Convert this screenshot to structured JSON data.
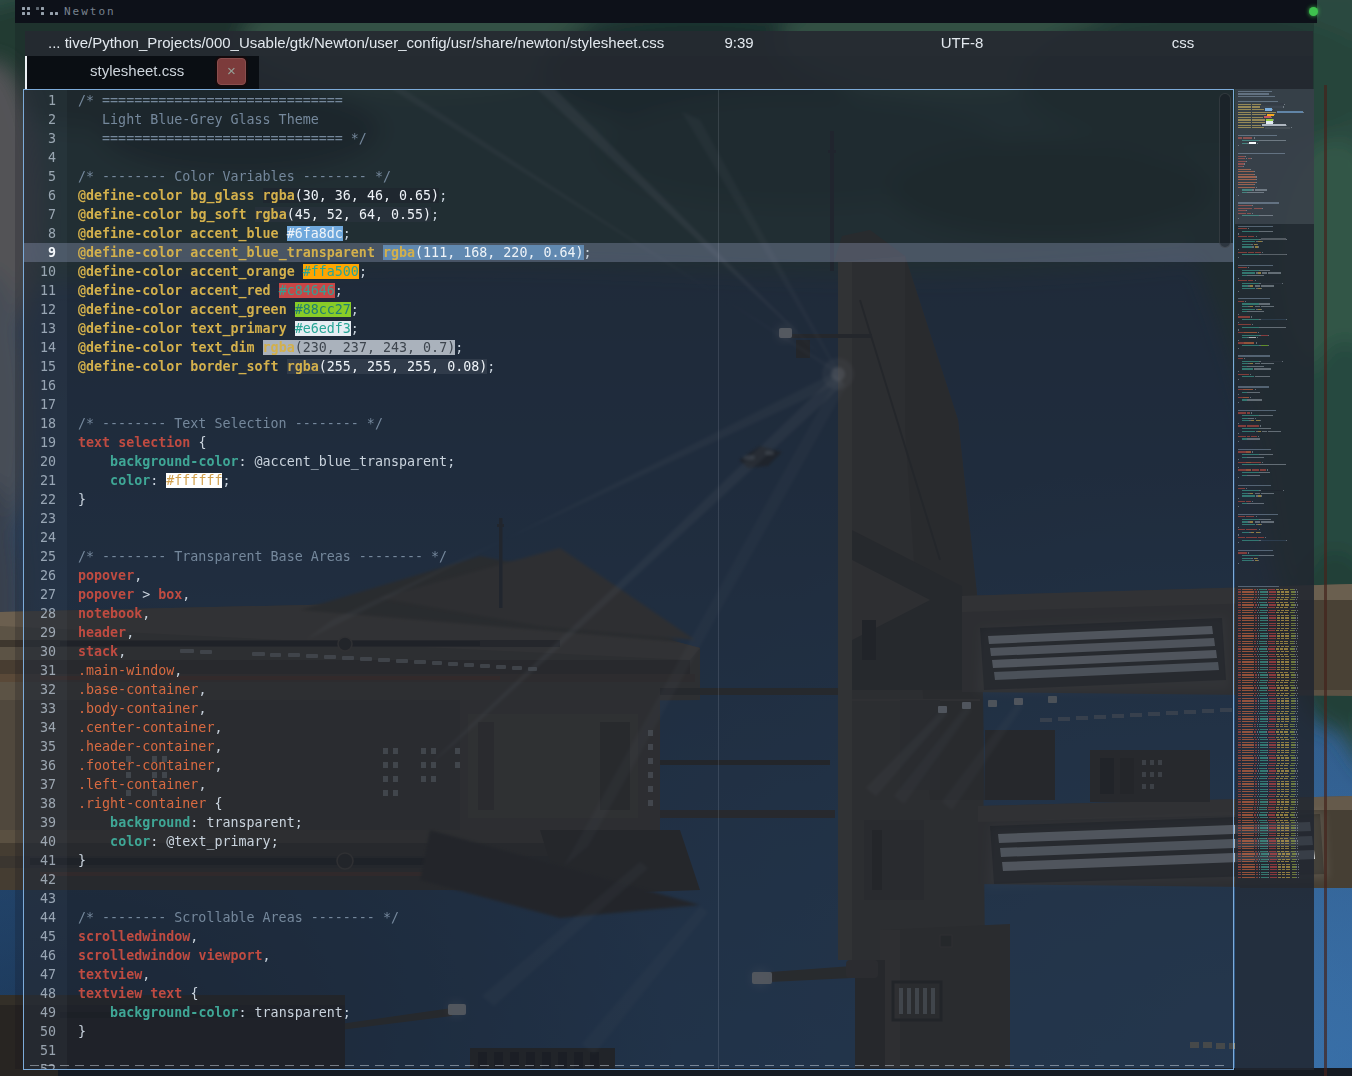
{
  "window": {
    "title": "Newton",
    "workspace_indicators": [
      {
        "name": "workspace-dots-1",
        "pattern": [
          1,
          1,
          1,
          1
        ]
      },
      {
        "name": "workspace-dots-2",
        "pattern": [
          1,
          1,
          0,
          1
        ]
      },
      {
        "name": "workspace-dots-3",
        "pattern": [
          0,
          0,
          1,
          1
        ]
      }
    ],
    "status_dot_color": "#3ec14e"
  },
  "pathbar": {
    "path": "... tive/Python_Projects/000_Usable/gtk/Newton/user_config/usr/share/newton/stylesheet.css",
    "cursor_position": "9:39",
    "encoding": "UTF-8",
    "language": "css"
  },
  "tabbar": {
    "tabs": [
      {
        "label": "stylesheet.css",
        "active": true,
        "close_label": "×"
      }
    ]
  },
  "editor": {
    "current_line": 9,
    "total_visible_lines": 52,
    "syntax_colors": {
      "comment": "#75889c",
      "keyword": "#d3b04c",
      "selector_element": "#bf4b41",
      "selector_class": "#d96a41",
      "property": "#3fa796",
      "foreground": "#c9d3dd",
      "number": "#d3b04c",
      "swatch_text_light": "#eef3f8",
      "swatch_text_dark": "#3e454e"
    },
    "hex_swatch_text": {
      "#6fa8dc": "#eef3f8",
      "#ffa500": "#27a596",
      "#c84646": "#35a093",
      "#88cc27": "#227f72",
      "#e6edf3": "#27a596",
      "#ffffff": "#d2a14e",
      "#9a4": "#99aa44"
    },
    "lines": [
      "/* ==============================",
      "   Light Blue-Grey Glass Theme",
      "   ============================== */",
      "",
      "/* -------- Color Variables -------- */",
      "@define-color bg_glass rgba(30, 36, 46, 0.65);",
      "@define-color bg_soft rgba(45, 52, 64, 0.55);",
      "@define-color accent_blue #6fa8dc;",
      "@define-color accent_blue_transparent rgba(111, 168, 220, 0.64);",
      "@define-color accent_orange #ffa500;",
      "@define-color accent_red #c84646;",
      "@define-color accent_green #88cc27;",
      "@define-color text_primary #e6edf3;",
      "@define-color text_dim rgba(230, 237, 243, 0.7);",
      "@define-color border_soft rgba(255, 255, 255, 0.08);",
      "",
      "",
      "/* -------- Text Selection -------- */",
      "text selection {",
      "    background-color: @accent_blue_transparent;",
      "    color: #ffffff;",
      "}",
      "",
      "",
      "/* -------- Transparent Base Areas -------- */",
      "popover,",
      "popover > box,",
      "notebook,",
      "header,",
      "stack,",
      ".main-window,",
      ".base-container,",
      ".body-container,",
      ".center-container,",
      ".header-container,",
      ".footer-container,",
      ".left-container,",
      ".right-container {",
      "    background: transparent;",
      "    color: @text_primary;",
      "}",
      "",
      "",
      "/* -------- Scrollable Areas -------- */",
      "scrolledwindow,",
      "scrolledwindow viewport,",
      "textview,",
      "textview text {",
      "    background-color: transparent;",
      "}",
      "",
      ""
    ],
    "file_continuation": [
      "/* -------- Scrollbars -------- */",
      "scrollbar {",
      "    background-color: transparent;",
      "}",
      "scrollbar slider {",
      "    background-color: rgba(230, 237, 243, 0.25);",
      "    border-radius: 10px;",
      "    min-width: 8px;",
      "    min-height: 8px;",
      "}",
      "scrollbar slider:hover {",
      "    background-color: rgba(230, 237, 243, 0.45);",
      "}",
      "",
      "",
      "/* -------- Header Bar -------- */",
      "headerbar {",
      "    background-color: @bg_soft;",
      "    border-bottom: 1px solid @border_soft;",
      "    color: @text_primary;",
      "}",
      "headerbar entry {",
      "    background-color: rgba(45, 52, 64, 0.8);",
      "    border: 1px solid @border_soft;",
      "    border-radius: 4px;",
      "}",
      "",
      "",
      "/* -------- Buttons -------- */",
      "button {",
      "    background-color: @bg_soft;",
      "    border: 1px solid @border_soft;",
      "    border-radius: 4px;",
      "    color: @text_primary;",
      "}",
      "button:hover {",
      "    background-color: rgba(111, 168, 220, 0.25);",
      "}",
      "button:active {",
      "    background-color: @accent_blue_transparent;",
      "}",
      "button.destructive {",
      "    background-color: #c84646;",
      "    color: #ffffff;",
      "}",
      "button.suggested {",
      "    background-color: #88cc27;",
      "}",
      "",
      "",
      "/* -------- Entries -------- */",
      "entry {",
      "    background-color: rgba(45, 52, 64, 0.8);",
      "    border: 1px solid @border_soft;",
      "    color: @text_primary;",
      "    caret-color: @accent_orange;",
      "}",
      "entry:focus {",
      "    border-color: @accent_blue;",
      "}",
      "",
      "",
      "/* -------- Labels -------- */",
      "label.dim-label {",
      "    color: @text_dim;",
      "}",
      "label.error {",
      "    color: @accent_red;",
      "}",
      "",
      "",
      "/* -------- Notebook Tabs -------- */",
      "notebook tab {",
      "    background-color: transparent;",
      "    border: none;",
      "    padding: 6px 12px;",
      "}",
      "notebook tab:checked {",
      "    background-color: @bg_glass;",
      "    border-bottom: 2px solid @accent_blue;",
      "}",
      "notebook tab label {",
      "    color: @text_dim;",
      "}",
      "",
      "",
      "/* -------- Treeview -------- */",
      "treeview.view {",
      "    background-color: transparent;",
      "    color: @text_primary;",
      "}",
      "treeview.view:selected {",
      "    background-color: @accent_blue_transparent;",
      "}",
      "treeview.view header button {",
      "    background-color: @bg_soft;",
      "    color: @text_dim;",
      "}",
      "",
      "",
      "/* -------- Tooltips -------- */",
      "tooltip {",
      "    background-color: rgba(30, 36, 46, 0.95);",
      "    border: 1px solid @border_soft;",
      "    border-radius: 4px;",
      "}",
      "tooltip label {",
      "    color: @text_primary;",
      "}",
      "",
      "",
      "/* -------- Popover Content -------- */",
      "popover contents {",
      "    background-color: @bg_glass;",
      "    border: 1px solid @border_soft;",
      "    border-radius: 6px;",
      "}",
      "popover modelbutton {",
      "    padding: 4px 10px;",
      "}",
      "popover modelbutton:hover {",
      "    background-color: rgba(111, 168, 220, 0.25);",
      "}",
      "",
      "",
      "/* -------- Separators -------- */",
      "separator {",
      "    background-color: @border_soft;",
      "    min-width: 1px;",
      "    min-height: 1px;",
      "}",
      "",
      "",
      "",
      "",
      "",
      "",
      "",
      "",
      "/* -------- Syntax Mark Rows -------- */",
      "row .mark-kw-00:i { outline: #c84646 1px 2px 0.10 #9a4; }",
      "row .mark-str-01:i { outline: #c84646 2px 3px 0.17 #9a4; }",
      "row .mark-cmt-02:i { outline: #c84646 3px 4px 0.24 #9a4; }",
      "row .mark-num-03:i { outline: #c84646 1px 5px 0.31 #9a4; }",
      "row .mark-fn-04:i { outline: #c84646 2px 2px 0.38 #9a4; }",
      "row .mark-op-05:i { outline: #c84646 3px 3px 0.45 #9a4; }",
      "row .mark-lit-06:i { outline: #c84646 1px 4px 0.52 #9a4; }",
      "row .mark-hd-07:i { outline: #c84646 2px 5px 0.59 #9a4; }",
      "row .mark-pre-08:i { outline: #c84646 3px 2px 0.66 #9a4; }",
      "row .mark-sp-09:i { outline: #c84646 1px 3px 0.73 #9a4; }",
      "row .mark-var-10:i { outline: #c84646 2px 4px 0.80 #9a4; }",
      "row .mark-cls-11:i { outline: #c84646 3px 5px 0.87 #9a4; }",
      "row .mark-tag-12:i { outline: #c84646 1px 2px 0.94 #9a4; }",
      "row .mark-att-13:i { outline: #c84646 2px 3px 0.16 #9a4; }",
      "row .mark-sel-14:i { outline: #c84646 3px 4px 0.23 #9a4; }",
      "row .mark-tok-15:i { outline: #c84646 1px 5px 0.30 #9a4; }",
      "row .mark-kw-16:i { outline: #c84646 2px 2px 0.37 #9a4; }",
      "row .mark-str-17:i { outline: #c84646 3px 3px 0.44 #9a4; }",
      "row .mark-cmt-18:i { outline: #c84646 1px 4px 0.51 #9a4; }",
      "row .mark-num-19:i { outline: #c84646 2px 5px 0.58 #9a4; }",
      "row .mark-fn-20:i { outline: #c84646 3px 2px 0.65 #9a4; }",
      "row .mark-op-21:i { outline: #c84646 1px 3px 0.72 #9a4; }",
      "row .mark-lit-22:i { outline: #c84646 2px 4px 0.79 #9a4; }",
      "row .mark-hd-23:i { outline: #c84646 3px 5px 0.86 #9a4; }",
      "row .mark-pre-24:i { outline: #c84646 1px 2px 0.93 #9a4; }",
      "row .mark-sp-25:i { outline: #c84646 2px 3px 0.15 #9a4; }",
      "row .mark-var-26:i { outline: #c84646 3px 4px 0.22 #9a4; }",
      "row .mark-cls-27:i { outline: #c84646 1px 5px 0.29 #9a4; }",
      "row .mark-tag-28:i { outline: #c84646 2px 2px 0.36 #9a4; }",
      "row .mark-att-29:i { outline: #c84646 3px 3px 0.43 #9a4; }",
      "row .mark-sel-30:i { outline: #c84646 1px 4px 0.50 #9a4; }",
      "row .mark-tok-31:i { outline: #c84646 2px 5px 0.57 #9a4; }",
      "row .mark-kw-32:i { outline: #c84646 3px 2px 0.64 #9a4; }",
      "row .mark-str-33:i { outline: #c84646 1px 3px 0.71 #9a4; }",
      "row .mark-cmt-34:i { outline: #c84646 2px 4px 0.78 #9a4; }",
      "row .mark-num-35:i { outline: #c84646 3px 5px 0.85 #9a4; }",
      "row .mark-fn-36:i { outline: #c84646 1px 2px 0.92 #9a4; }",
      "row .mark-op-37:i { outline: #c84646 2px 3px 0.14 #9a4; }",
      "row .mark-lit-38:i { outline: #c84646 3px 4px 0.21 #9a4; }",
      "row .mark-hd-39:i { outline: #c84646 1px 5px 0.28 #9a4; }",
      "row .mark-pre-40:i { outline: #c84646 2px 2px 0.35 #9a4; }",
      "row .mark-sp-41:i { outline: #c84646 3px 3px 0.42 #9a4; }",
      "row .mark-var-42:i { outline: #c84646 1px 4px 0.49 #9a4; }",
      "row .mark-cls-43:i { outline: #c84646 2px 5px 0.56 #9a4; }",
      "row .mark-tag-44:i { outline: #c84646 3px 2px 0.63 #9a4; }",
      "row .mark-att-45:i { outline: #c84646 1px 3px 0.70 #9a4; }",
      "row .mark-sel-46:i { outline: #c84646 2px 4px 0.77 #9a4; }",
      "row .mark-tok-47:i { outline: #c84646 3px 5px 0.84 #9a4; }",
      "row .mark-kw-48:i { outline: #c84646 1px 2px 0.91 #9a4; }",
      "row .mark-str-49:i { outline: #c84646 2px 3px 0.13 #9a4; }",
      "row .mark-cmt-50:i { outline: #c84646 3px 4px 0.20 #9a4; }",
      "row .mark-num-51:i { outline: #c84646 1px 5px 0.27 #9a4; }",
      "row .mark-fn-52:i { outline: #c84646 2px 2px 0.34 #9a4; }",
      "row .mark-op-53:i { outline: #c84646 3px 3px 0.41 #9a4; }",
      "row .mark-lit-54:i { outline: #c84646 1px 4px 0.48 #9a4; }",
      "row .mark-hd-55:i { outline: #c84646 2px 5px 0.55 #9a4; }",
      "row .mark-pre-56:i { outline: #c84646 3px 2px 0.62 #9a4; }",
      "row .mark-sp-57:i { outline: #c84646 1px 3px 0.69 #9a4; }",
      "row .mark-var-58:i { outline: #c84646 2px 4px 0.76 #9a4; }",
      "row .mark-cls-59:i { outline: #c84646 3px 5px 0.83 #9a4; }",
      "row .mark-tag-60:i { outline: #c84646 1px 2px 0.90 #9a4; }",
      "row .mark-att-61:i { outline: #c84646 2px 3px 0.12 #9a4; }",
      "row .mark-sel-62:i { outline: #c84646 3px 4px 0.19 #9a4; }",
      "row .mark-tok-63:i { outline: #c84646 1px 5px 0.26 #9a4; }",
      "row .mark-kw-64:i { outline: #c84646 2px 2px 0.33 #9a4; }",
      "row .mark-str-65:i { outline: #c84646 3px 3px 0.40 #9a4; }",
      "row .mark-cmt-66:i { outline: #c84646 1px 4px 0.47 #9a4; }",
      "row .mark-num-67:i { outline: #c84646 2px 5px 0.54 #9a4; }",
      "row .mark-fn-68:i { outline: #c84646 3px 2px 0.61 #9a4; }",
      "row .mark-op-69:i { outline: #c84646 1px 3px 0.68 #9a4; }",
      "row .mark-lit-70:i { outline: #c84646 2px 4px 0.75 #9a4; }",
      "row .mark-hd-71:i { outline: #c84646 3px 5px 0.82 #9a4; }",
      "row .mark-pre-72:i { outline: #c84646 1px 2px 0.89 #9a4; }",
      "row .mark-sp-73:i { outline: #c84646 2px 3px 0.11 #9a4; }",
      "row .mark-var-74:i { outline: #c84646 3px 4px 0.18 #9a4; }",
      "row .mark-cls-75:i { outline: #c84646 1px 5px 0.25 #9a4; }",
      "row .mark-tag-76:i { outline: #c84646 2px 2px 0.32 #9a4; }",
      "row .mark-att-77:i { outline: #c84646 3px 3px 0.39 #9a4; }",
      "row .mark-sel-78:i { outline: #c84646 1px 4px 0.46 #9a4; }",
      "row .mark-tok-79:i { outline: #c84646 2px 5px 0.53 #9a4; }",
      "row .mark-kw-80:i { outline: #c84646 3px 2px 0.60 #9a4; }",
      "row .mark-str-81:i { outline: #c84646 1px 3px 0.67 #9a4; }",
      "row .mark-cmt-82:i { outline: #c84646 2px 4px 0.74 #9a4; }",
      "row .mark-num-83:i { outline: #c84646 3px 5px 0.81 #9a4; }",
      "row .mark-fn-84:i { outline: #c84646 1px 2px 0.88 #9a4; }",
      "row .mark-op-85:i { outline: #c84646 2px 3px 0.10 #9a4; }",
      "row .mark-lit-86:i { outline: #c84646 3px 4px 0.17 #9a4; }",
      "row .mark-hd-87:i { outline: #c84646 1px 5px 0.24 #9a4; }",
      "row .mark-pre-88:i { outline: #c84646 2px 2px 0.31 #9a4; }",
      "row .mark-sp-89:i { outline: #c84646 3px 3px 0.38 #9a4; }",
      "row .mark-var-90:i { outline: #c84646 1px 4px 0.45 #9a4; }",
      "row .mark-cls-91:i { outline: #c84646 2px 5px 0.52 #9a4; }",
      "row .mark-tag-92:i { outline: #c84646 3px 2px 0.59 #9a4; }",
      "row .mark-att-93:i { outline: #c84646 1px 3px 0.66 #9a4; }",
      "row .mark-sel-94:i { outline: #c84646 2px 4px 0.73 #9a4; }",
      "row .mark-tok-95:i { outline: #c84646 3px 5px 0.80 #9a4; }",
      "row .mark-kw-96:i { outline: #c84646 1px 2px 0.87 #9a4; }",
      "row .mark-str-97:i { outline: #c84646 2px 3px 0.94 #9a4; }",
      "row .mark-cmt-98:i { outline: #c84646 3px 4px 0.16 #9a4; }",
      "row .mark-num-99:i { outline: #c84646 1px 5px 0.23 #9a4; }",
      "row .mark-fn-100:i { outline: #c84646 2px 2px 0.30 #9a4; }",
      "row .mark-op-101:i { outline: #c84646 3px 3px 0.37 #9a4; }",
      "row .mark-lit-102:i { outline: #c84646 1px 4px 0.44 #9a4; }",
      "row .mark-hd-103:i { outline: #c84646 2px 5px 0.51 #9a4; }",
      "row .mark-pre-104:i { outline: #c84646 3px 2px 0.58 #9a4; }",
      "row .mark-sp-105:i { outline: #c84646 1px 3px 0.65 #9a4; }",
      "row .mark-var-106:i { outline: #c84646 2px 4px 0.72 #9a4; }",
      "row .mark-cls-107:i { outline: #c84646 3px 5px 0.79 #9a4; }",
      "row .mark-tag-108:i { outline: #c84646 1px 2px 0.86 #9a4; }",
      "row .mark-att-109:i { outline: #c84646 2px 3px 0.93 #9a4; }",
      "row .mark-sel-110:i { outline: #c84646 3px 4px 0.15 #9a4; }",
      "row .mark-tok-111:i { outline: #c84646 1px 5px 0.22 #9a4; }",
      "",
      ""
    ]
  }
}
